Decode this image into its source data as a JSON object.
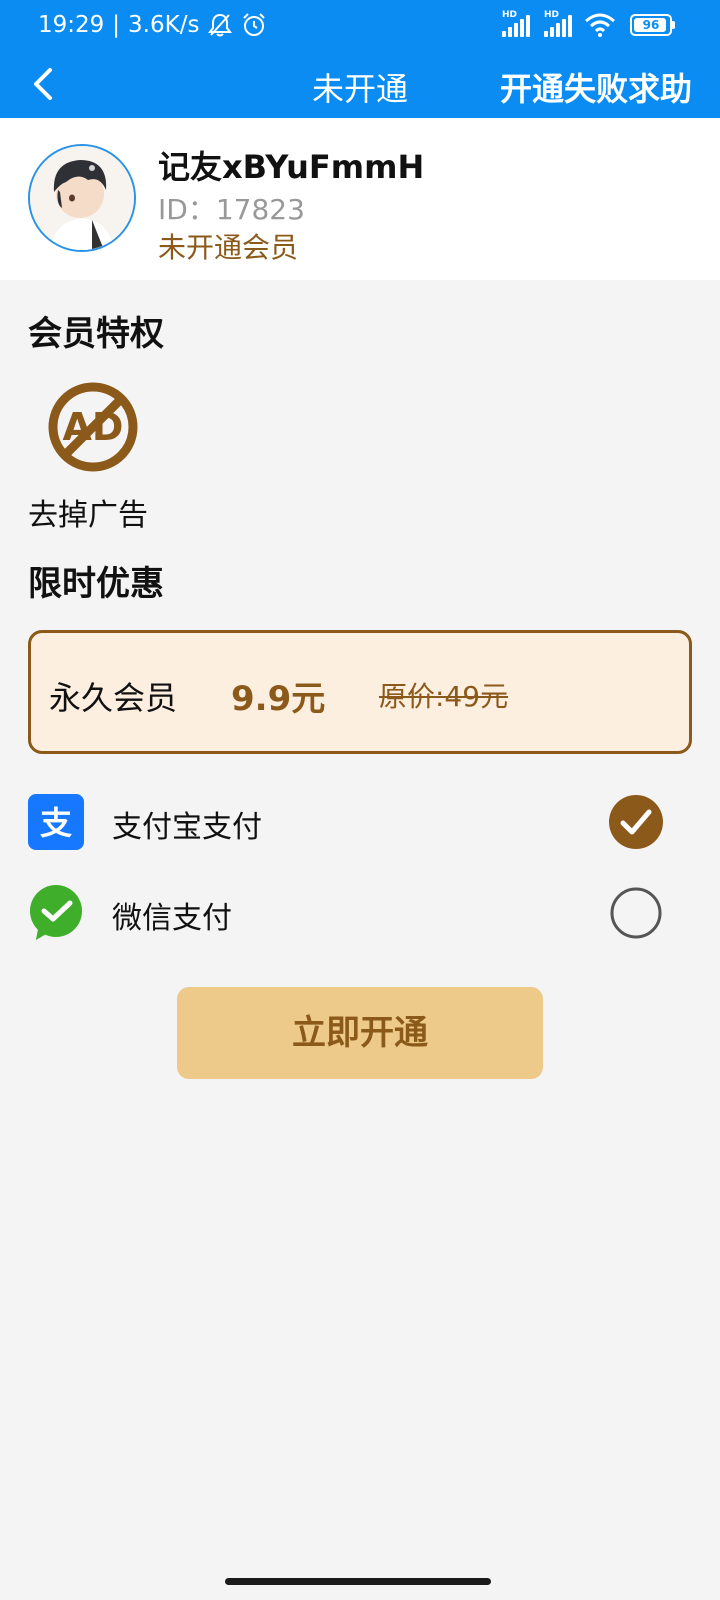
{
  "status_bar": {
    "time": "19:29",
    "separator": "|",
    "net_speed": "3.6K/s",
    "signal_label_1": "HD",
    "signal_label_2": "HD",
    "battery": "96"
  },
  "nav": {
    "back_icon": "chevron-left-icon",
    "title": "未开通",
    "help_label": "开通失败求助"
  },
  "user": {
    "name": "记友xBYuFmmH",
    "id": "ID：17823",
    "status": "未开通会员"
  },
  "privileges": {
    "title": "会员特权",
    "items": [
      {
        "icon": "no-ads-icon",
        "label": "去掉广告"
      }
    ]
  },
  "offers": {
    "title": "限时优惠",
    "plan": {
      "name": "永久会员",
      "price": "9.9元",
      "original_price": "原价:49元"
    }
  },
  "payment": {
    "options": [
      {
        "icon": "alipay-icon",
        "label": "支付宝支付",
        "selected": true
      },
      {
        "icon": "wechat-pay-icon",
        "label": "微信支付",
        "selected": false
      }
    ]
  },
  "actions": {
    "open_button": "立即开通"
  },
  "colors": {
    "header_blue": "#0a8cf3",
    "accent_brown": "#8b5a1b",
    "button_gold": "#edc98a",
    "plan_bg": "#fdefe0",
    "alipay_blue": "#1677ff",
    "wechat_green": "#3fae2a"
  }
}
